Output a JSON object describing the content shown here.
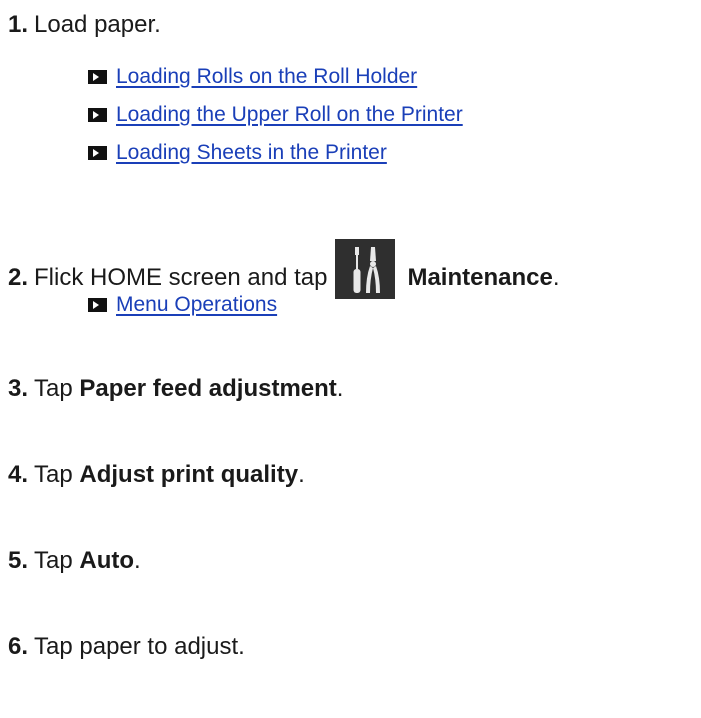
{
  "steps": [
    {
      "number": "1.",
      "text": "Load paper.",
      "links": [
        "Loading Rolls on the Roll Holder",
        "Loading the Upper Roll on the Printer",
        "Loading Sheets in the Printer"
      ]
    },
    {
      "number": "2.",
      "prefix": "Flick HOME screen and tap",
      "icon": "maintenance-icon",
      "bold": "Maintenance",
      "suffix": ".",
      "links": [
        "Menu Operations"
      ]
    },
    {
      "number": "3.",
      "prefix": "Tap ",
      "bold": "Paper feed adjustment",
      "suffix": "."
    },
    {
      "number": "4.",
      "prefix": "Tap ",
      "bold": "Adjust print quality",
      "suffix": "."
    },
    {
      "number": "5.",
      "prefix": "Tap ",
      "bold": "Auto",
      "suffix": "."
    },
    {
      "number": "6.",
      "text": "Tap paper to adjust."
    }
  ],
  "colors": {
    "link": "#1a3fb8",
    "link_icon": "#111111",
    "maintenance_icon_bg": "#2f2f2f"
  }
}
